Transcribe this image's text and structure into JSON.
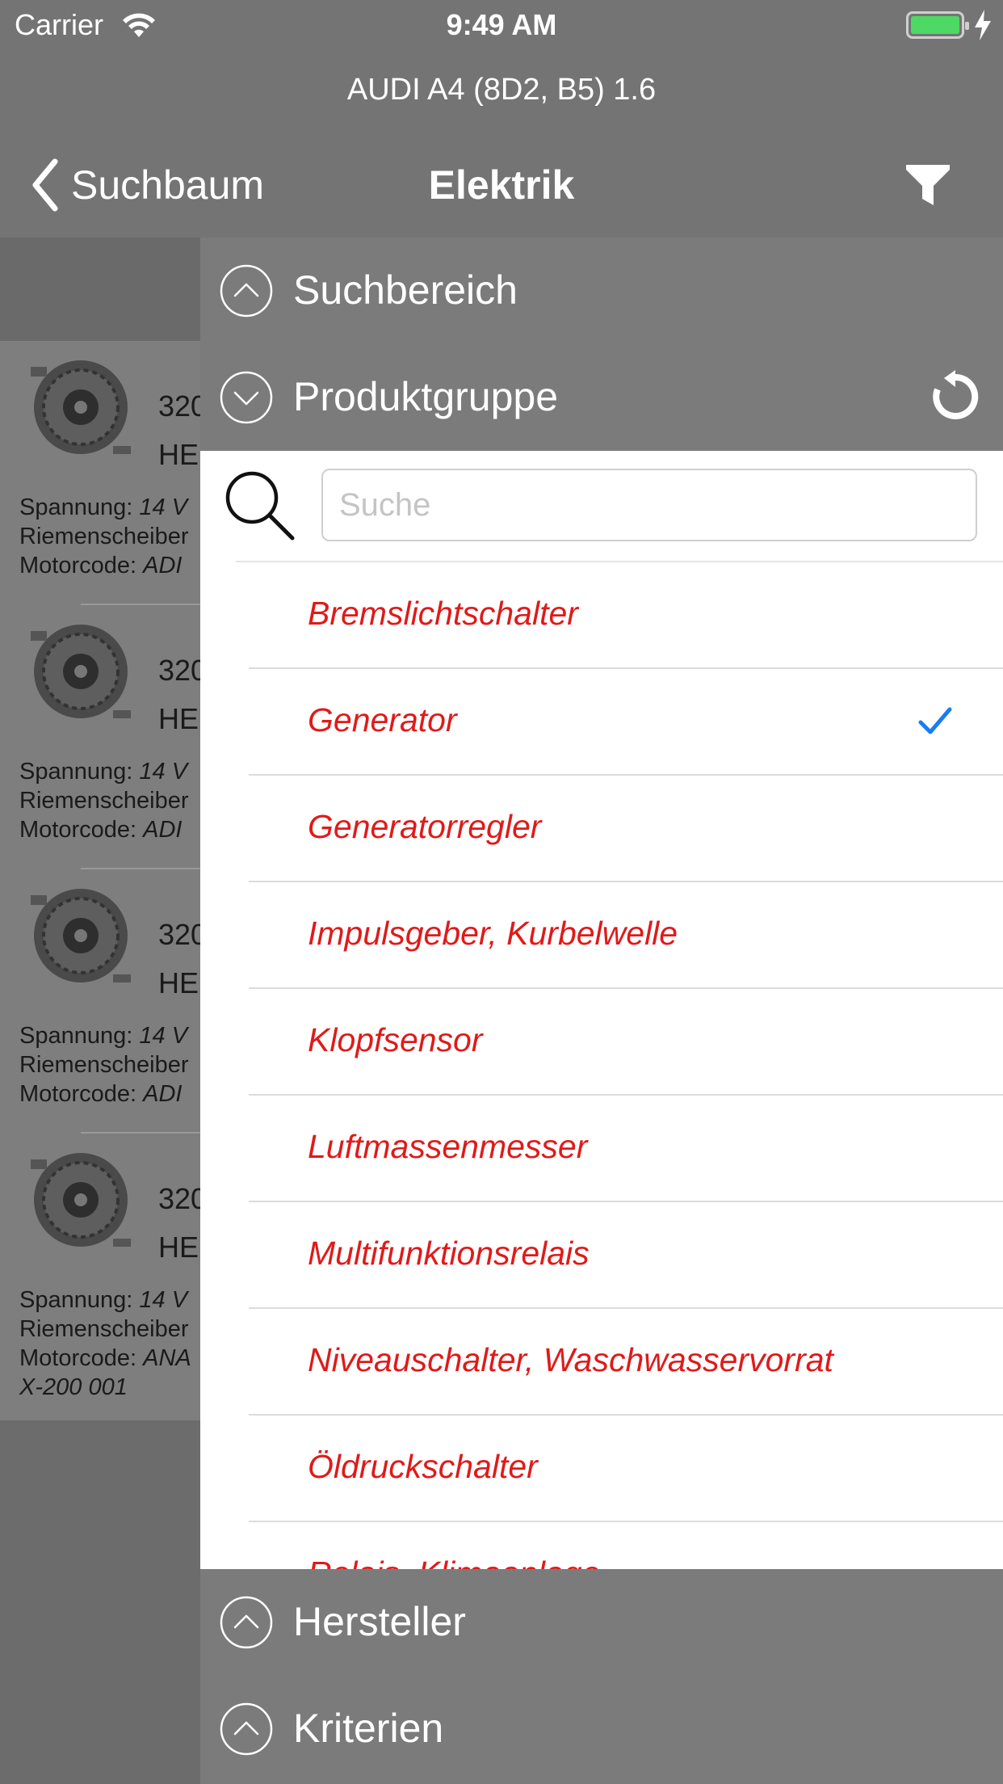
{
  "status_bar": {
    "carrier": "Carrier",
    "time": "9:49 AM",
    "battery_color": "#4cd964"
  },
  "nav": {
    "subtitle": "AUDI A4 (8D2, B5) 1.6",
    "back_label": "Suchbaum",
    "title": "Elektrik",
    "filter_icon": "filter-icon"
  },
  "background_list": {
    "items": [
      {
        "number": "320",
        "brand": "HEI",
        "spannung_label": "Spannung:",
        "spannung_value": "14 V",
        "riemen_label": "Riemenscheiber",
        "motor_label": "Motorcode:",
        "motor_value": "ADI",
        "extra": ""
      },
      {
        "number": "320",
        "brand": "HEI",
        "spannung_label": "Spannung:",
        "spannung_value": "14 V",
        "riemen_label": "Riemenscheiber",
        "motor_label": "Motorcode:",
        "motor_value": "ADI",
        "extra": ""
      },
      {
        "number": "320",
        "brand": "HEI",
        "spannung_label": "Spannung:",
        "spannung_value": "14 V",
        "riemen_label": "Riemenscheiber",
        "motor_label": "Motorcode:",
        "motor_value": "ADI",
        "extra": ""
      },
      {
        "number": "320",
        "brand": "HEI",
        "spannung_label": "Spannung:",
        "spannung_value": "14 V",
        "riemen_label": "Riemenscheiber",
        "motor_label": "Motorcode:",
        "motor_value": "ANA",
        "extra": "X-200 001"
      }
    ]
  },
  "panel": {
    "sections": {
      "suchbereich": "Suchbereich",
      "produktgruppe": "Produktgruppe",
      "hersteller": "Hersteller",
      "kriterien": "Kriterien"
    },
    "search": {
      "placeholder": "Suche",
      "value": ""
    },
    "accent_color": "#e01a1a",
    "check_color": "#1a7cf5",
    "product_groups": [
      {
        "label": "Bremslichtschalter",
        "selected": false
      },
      {
        "label": "Generator",
        "selected": true
      },
      {
        "label": "Generatorregler",
        "selected": false
      },
      {
        "label": "Impulsgeber, Kurbelwelle",
        "selected": false
      },
      {
        "label": "Klopfsensor",
        "selected": false
      },
      {
        "label": "Luftmassenmesser",
        "selected": false
      },
      {
        "label": "Multifunktionsrelais",
        "selected": false
      },
      {
        "label": "Niveauschalter, Waschwasservorrat",
        "selected": false
      },
      {
        "label": "Öldruckschalter",
        "selected": false
      },
      {
        "label": "Relais, Klimaanlage",
        "selected": false
      }
    ]
  }
}
